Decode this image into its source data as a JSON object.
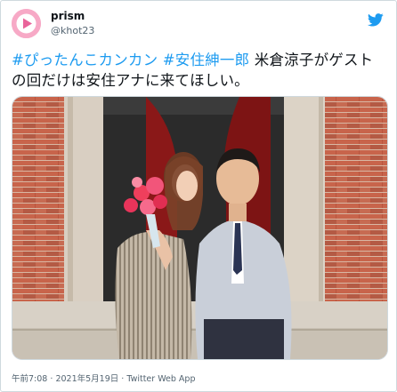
{
  "user": {
    "display_name": "prism",
    "handle": "@khot23",
    "avatar_icon": "play-circle-icon",
    "avatar_color": "#f7a9c6"
  },
  "tweet": {
    "hashtag1": "#ぴったんこカンカン",
    "hashtag2": "#安住紳一郎",
    "text_rest": "米倉涼子がゲスト の回だけは安住アナに来てほしい。"
  },
  "meta": {
    "time": "午前7:08",
    "date": "2021年5月19日",
    "source": "Twitter Web App"
  },
  "colors": {
    "link": "#1d9bf0",
    "brand": "#1d9bf0",
    "secondary_text": "#536471"
  },
  "icons": [
    "play-circle-icon",
    "twitter-bird-icon"
  ]
}
